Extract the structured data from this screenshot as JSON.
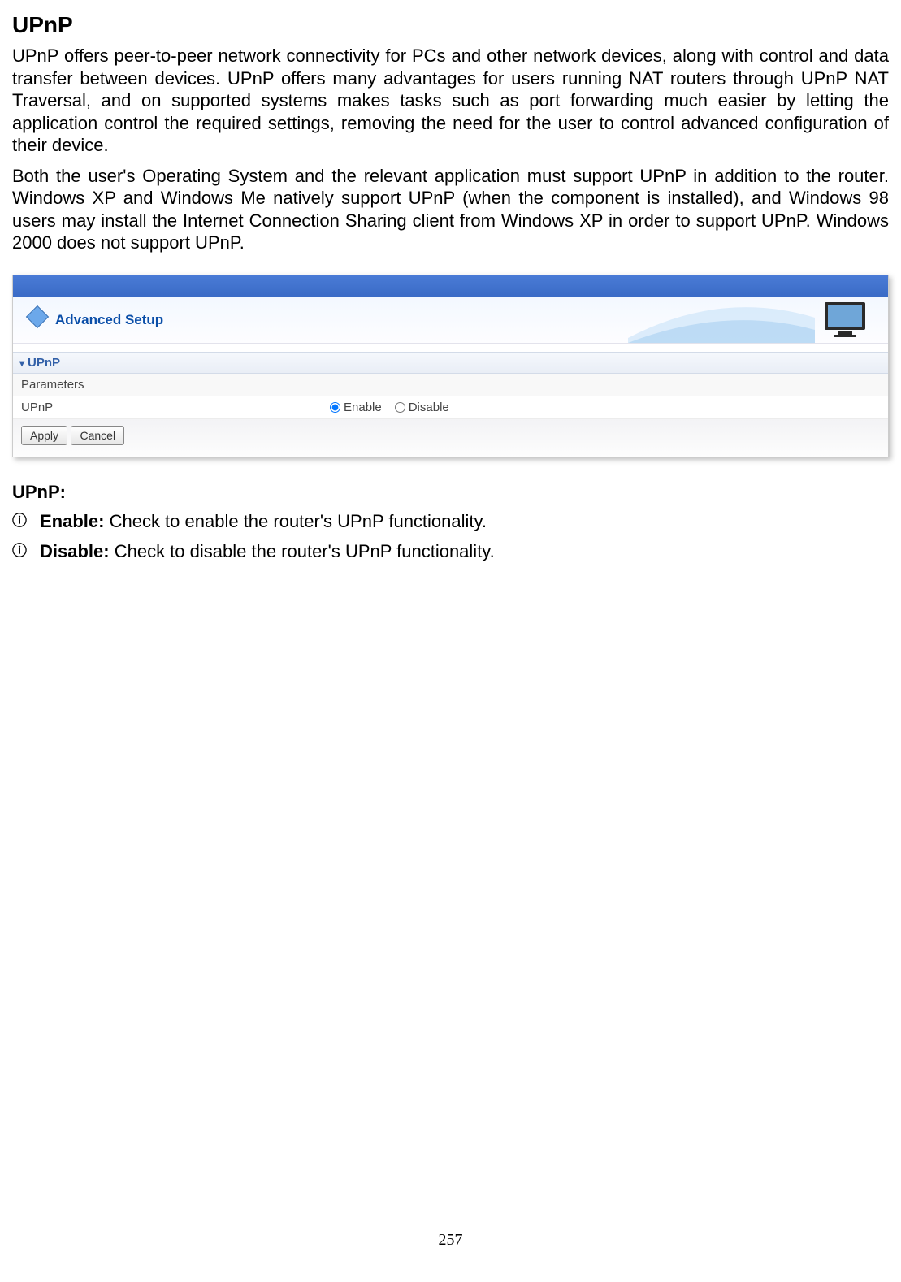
{
  "page": {
    "title": "UPnP",
    "paragraph1": "UPnP offers peer-to-peer network connectivity for PCs and other network devices, along with control and data transfer between devices. UPnP offers many advantages for users running NAT routers through UPnP NAT Traversal, and on supported systems makes tasks such as port forwarding much easier by letting the application control the required settings, removing the need for the user to control advanced configuration of their device.",
    "paragraph2": "Both the user's Operating System and the relevant application must support UPnP in addition to the router. Windows XP and Windows Me natively support UPnP (when the component is installed), and Windows 98 users may install the Internet Connection Sharing client from Windows XP in order to support UPnP. Windows 2000 does not support UPnP.",
    "subheading": "UPnP:",
    "options": {
      "enable": {
        "label": "Enable:",
        "desc": " Check to enable the router's UPnP functionality."
      },
      "disable": {
        "label": "Disable:",
        "desc": " Check to disable the router's UPnP functionality."
      }
    },
    "number": "257"
  },
  "ui": {
    "headerTitle": "Advanced Setup",
    "sectionTitle": "UPnP",
    "paramsLabel": "Parameters",
    "fieldLabel": "UPnP",
    "radioEnable": "Enable",
    "radioDisable": "Disable",
    "applyLabel": "Apply",
    "cancelLabel": "Cancel"
  }
}
